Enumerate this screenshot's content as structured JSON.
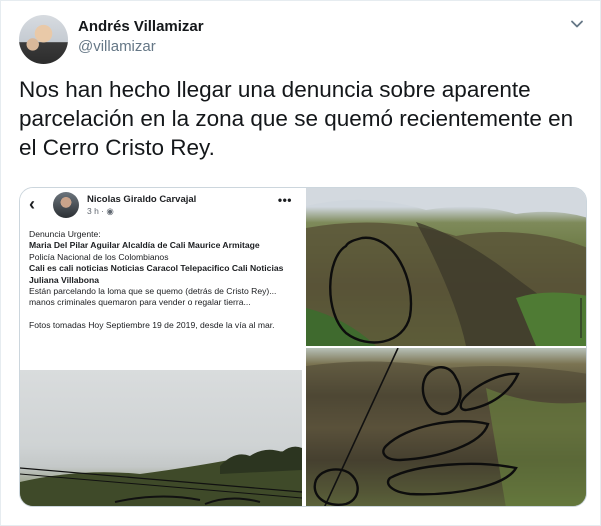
{
  "tweet": {
    "author_name": "Andrés Villamizar",
    "author_handle": "@villamizar",
    "text": "Nos han hecho llegar una denuncia sobre aparente parcelación en la zona que se quemó recientemente en el Cerro Cristo Rey.",
    "menu_icon": "chevron-down-icon"
  },
  "embedded_post": {
    "back_glyph": "‹",
    "author_name": "Nicolas Giraldo Carvajal",
    "meta": "3 h · ",
    "more_glyph": "•••",
    "lines": {
      "l1": "Denuncia Urgente:",
      "l2": "Maria Del Pilar Aguilar Alcaldía de Cali Maurice Armitage",
      "l3": "Policía Nacional de los Colombianos",
      "l4": "Cali es cali noticias Noticias Caracol Telepacifico Cali Noticias Juliana Villabona",
      "l5": "Están parcelando la loma que se quemo (detrás de Cristo Rey)... manos criminales quemaron para vender o regalar tierra...",
      "l6": "Fotos tomadas Hoy Septiembre 19 de 2019, desde la vía al mar."
    }
  },
  "colors": {
    "text": "#14171a",
    "secondary": "#657786",
    "border": "#e6ecf0"
  }
}
